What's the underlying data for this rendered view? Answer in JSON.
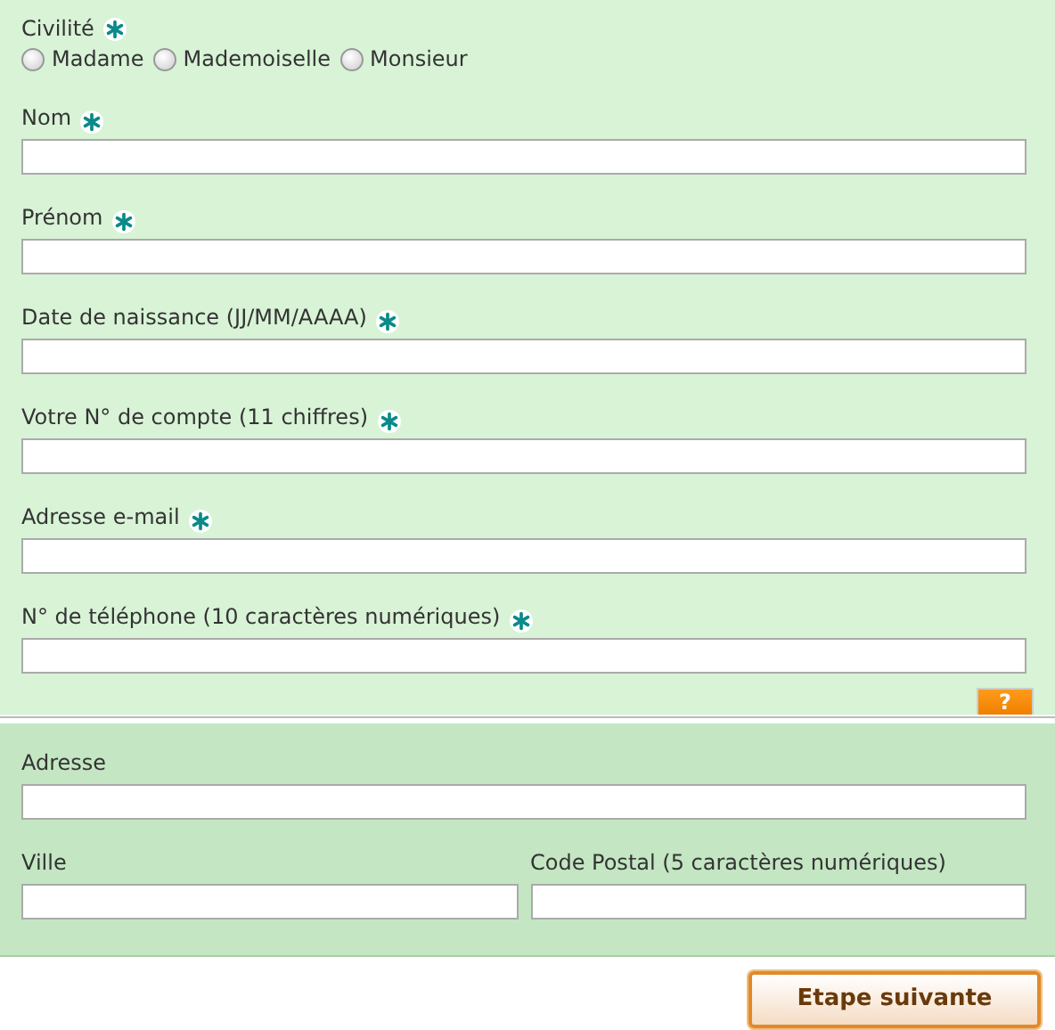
{
  "civility": {
    "label": "Civilité",
    "required": true,
    "options": [
      {
        "label": "Madame",
        "selected": false
      },
      {
        "label": "Mademoiselle",
        "selected": false
      },
      {
        "label": "Monsieur",
        "selected": false
      }
    ]
  },
  "fields": [
    {
      "label": "Nom",
      "required": true
    },
    {
      "label": "Prénom",
      "required": true
    },
    {
      "label": "Date de naissance (JJ/MM/AAAA)",
      "required": true
    },
    {
      "label": "Votre N° de compte (11 chiffres)",
      "required": true
    },
    {
      "label": "Adresse e-mail",
      "required": true
    },
    {
      "label": "N° de téléphone (10 caractères numériques)",
      "required": true
    }
  ],
  "help_button": "?",
  "address": {
    "label": "Adresse",
    "required": false
  },
  "address_row": [
    {
      "label": "Ville",
      "required": false
    },
    {
      "label": "Code Postal (5 caractères numériques)",
      "required": false
    }
  ],
  "next_button": "Etape suivante"
}
